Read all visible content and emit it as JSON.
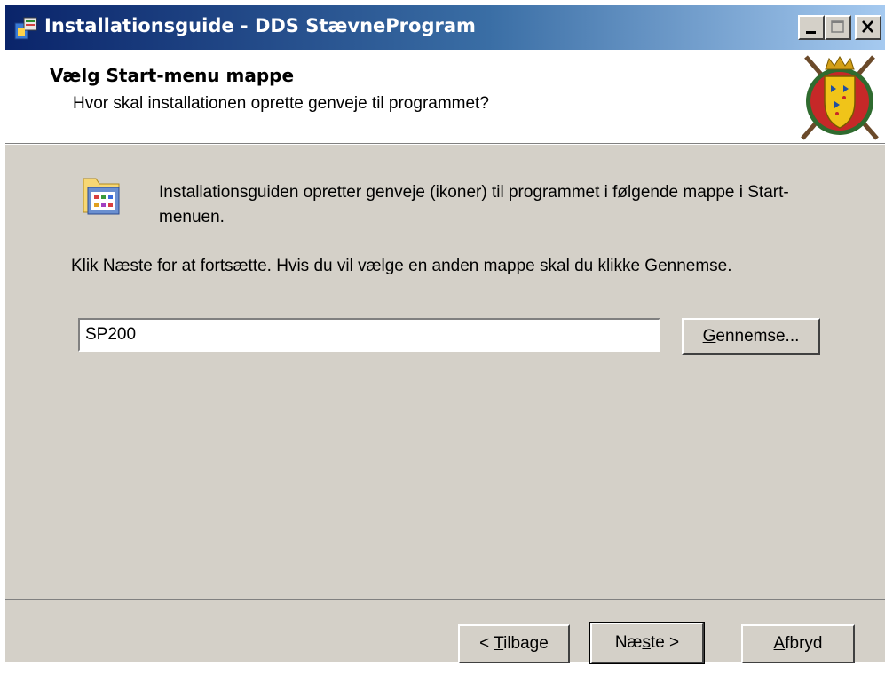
{
  "window": {
    "title": "Installationsguide - DDS StævneProgram"
  },
  "header": {
    "title": "Vælg Start-menu mappe",
    "subtitle": "Hvor skal installationen oprette genveje til programmet?"
  },
  "body": {
    "info_text": "Installationsguiden opretter genveje (ikoner) til programmet i følgende mappe i Start-menuen.",
    "instruction_text": "Klik Næste for at fortsætte. Hvis du vil vælge en anden mappe skal du klikke Gennemse.",
    "folder_value": "SP200",
    "browse": {
      "pre": "",
      "mnemonic": "G",
      "post": "ennemse..."
    }
  },
  "buttons": {
    "back": {
      "pre": "< ",
      "mnemonic": "T",
      "post": "ilbage"
    },
    "next": {
      "pre": "Næ",
      "mnemonic": "s",
      "post": "te >"
    },
    "cancel": {
      "pre": "",
      "mnemonic": "A",
      "post": "fbryd"
    }
  },
  "icons": {
    "title": "installer-icon",
    "logo": "dds-crest-logo",
    "folder": "start-menu-folder-icon",
    "minimize": "minimize-icon",
    "maximize": "maximize-icon",
    "close": "close-icon"
  },
  "colors": {
    "titlebar_start": "#0a246a",
    "titlebar_end": "#a6caf0",
    "dialog_bg": "#d4d0c8",
    "header_bg": "#ffffff"
  }
}
